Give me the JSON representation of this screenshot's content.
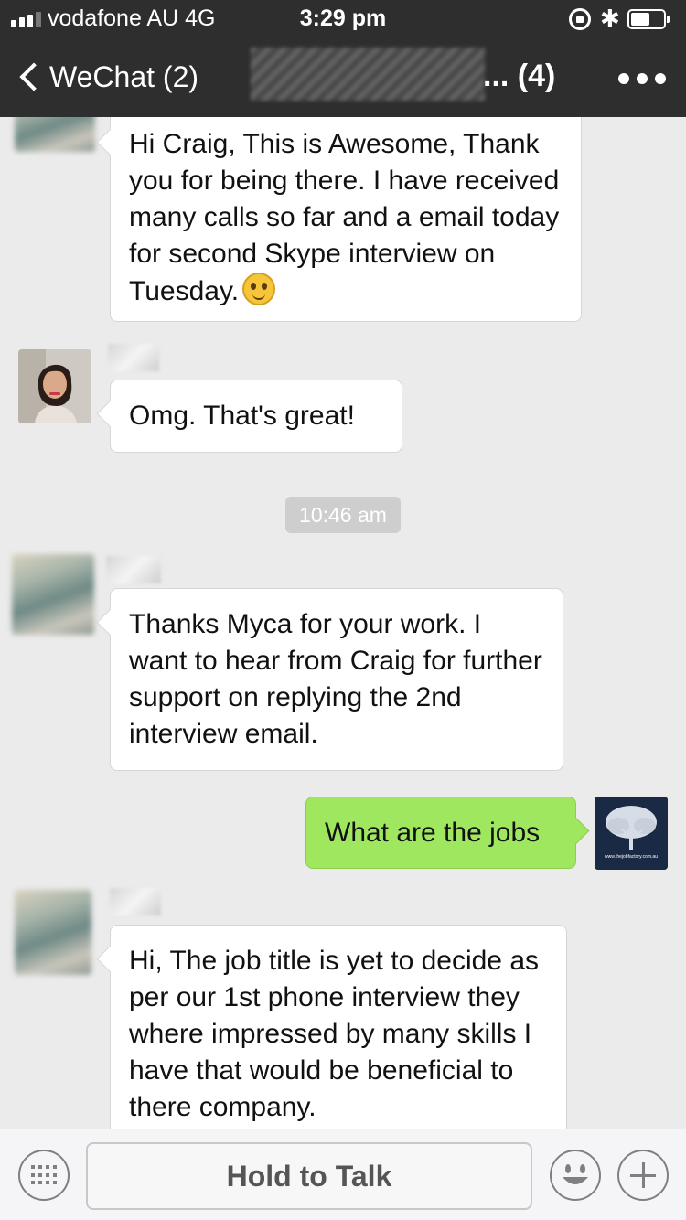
{
  "status_bar": {
    "carrier": "vodafone AU  4G",
    "time": "3:29 pm"
  },
  "nav": {
    "back_label": "WeChat (2)",
    "title_suffix": "... (4)"
  },
  "messages": [
    {
      "direction": "in",
      "text": "Hi Craig, This is Awesome, Thank you for being there. I have received many calls so far and a email today for second Skype interview on Tuesday."
    },
    {
      "direction": "in",
      "text": "Omg. That's great!"
    },
    {
      "direction": "in",
      "text": "Thanks Myca for your work. I want to hear from Craig for further support on replying the 2nd interview email."
    },
    {
      "direction": "out",
      "text": "What are the jobs"
    },
    {
      "direction": "in",
      "text": "Hi, The job title is yet to decide as per our 1st phone interview they where impressed by many skills I have that would be beneficial to there company."
    }
  ],
  "timestamp": "10:46 am",
  "avatar_caption": "www.thejobfactory.com.au",
  "input_bar": {
    "hold_to_talk": "Hold to Talk"
  }
}
